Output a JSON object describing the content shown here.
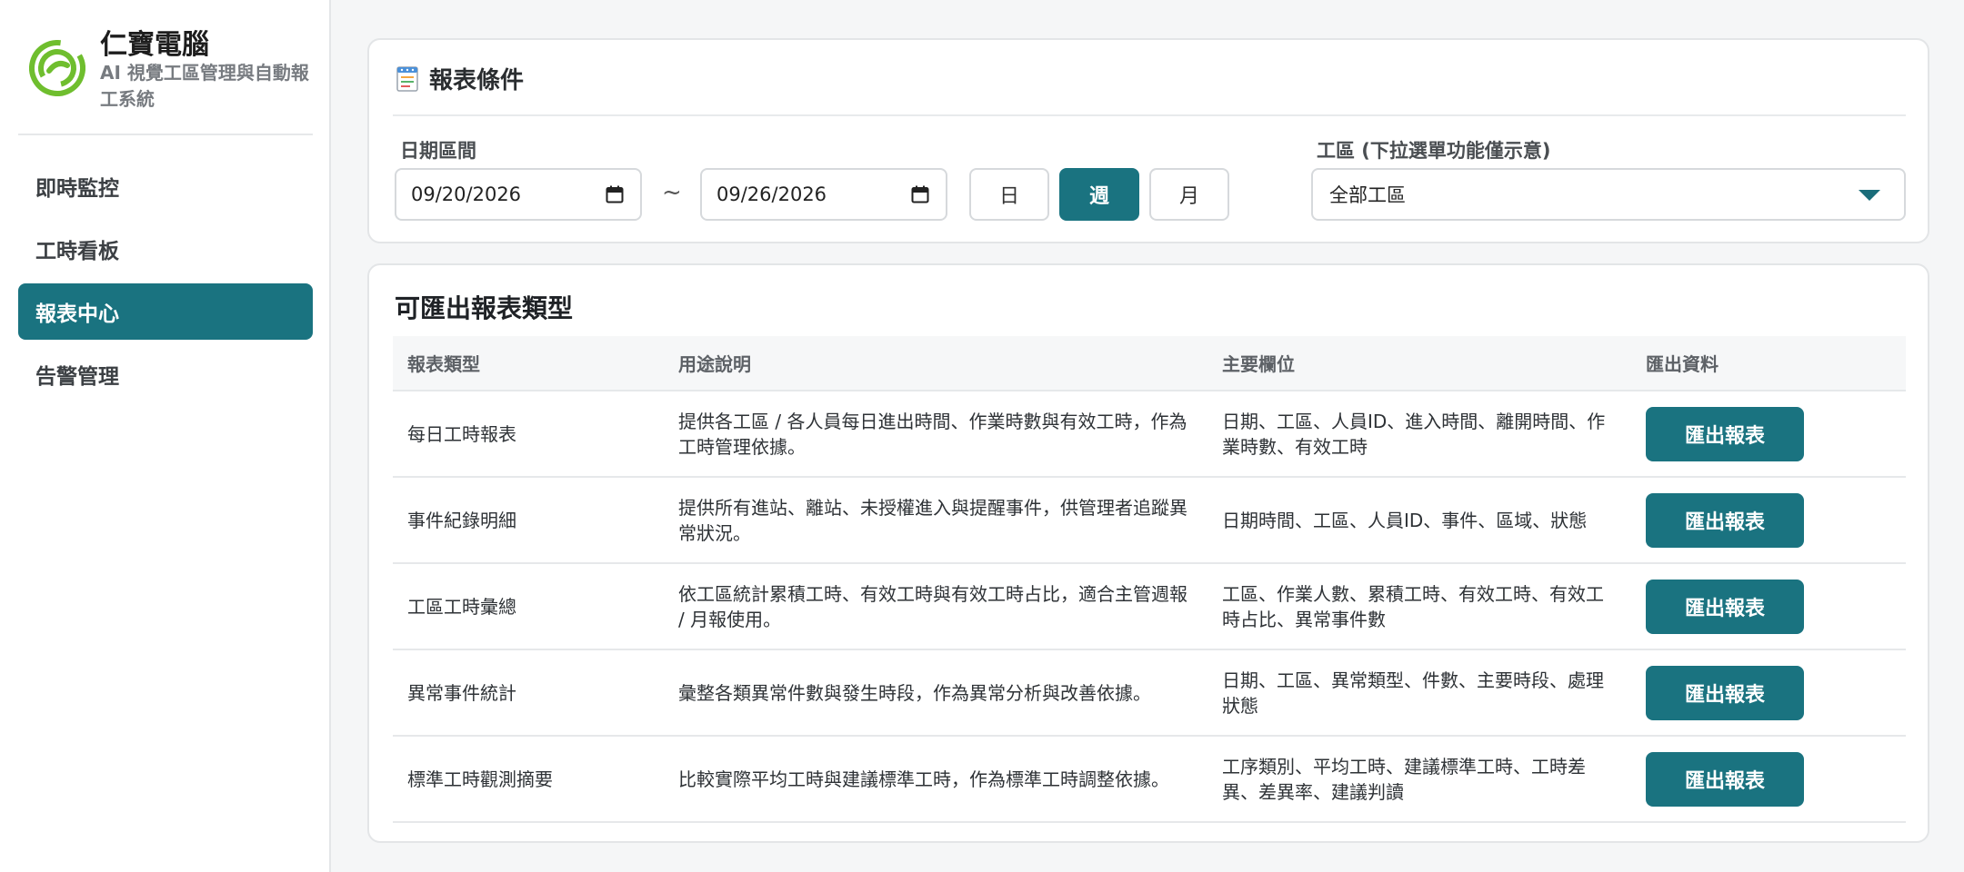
{
  "brand": {
    "name": "仁寶電腦",
    "subtitle": "AI 視覺工區管理與自動報工系統",
    "logo_color": "#6fbe2e"
  },
  "nav": {
    "items": [
      {
        "label": "即時監控",
        "active": false
      },
      {
        "label": "工時看板",
        "active": false
      },
      {
        "label": "報表中心",
        "active": true
      },
      {
        "label": "告警管理",
        "active": false
      }
    ]
  },
  "criteria": {
    "title": "報表條件",
    "date_label": "日期區間",
    "start_date": "09/20/2026",
    "separator": "~",
    "end_date": "09/26/2026",
    "period_buttons": [
      {
        "label": "日",
        "active": false
      },
      {
        "label": "週",
        "active": true
      },
      {
        "label": "月",
        "active": false
      }
    ],
    "zone_label": "工區 (下拉選單功能僅示意)",
    "zone_value": "全部工區"
  },
  "report_types": {
    "title": "可匯出報表類型",
    "headers": [
      "報表類型",
      "用途說明",
      "主要欄位",
      "匯出資料"
    ],
    "rows": [
      {
        "type": "每日工時報表",
        "description": "提供各工區 / 各人員每日進出時間、作業時數與有效工時，作為工時管理依據。",
        "fields": "日期、工區、人員ID、進入時間、離開時間、作業時數、有效工時",
        "button": "匯出報表"
      },
      {
        "type": "事件紀錄明細",
        "description": "提供所有進站、離站、未授權進入與提醒事件，供管理者追蹤異常狀況。",
        "fields": "日期時間、工區、人員ID、事件、區域、狀態",
        "button": "匯出報表"
      },
      {
        "type": "工區工時彙總",
        "description": "依工區統計累積工時、有效工時與有效工時占比，適合主管週報 / 月報使用。",
        "fields": "工區、作業人數、累積工時、有效工時、有效工時占比、異常事件數",
        "button": "匯出報表"
      },
      {
        "type": "異常事件統計",
        "description": "彙整各類異常件數與發生時段，作為異常分析與改善依據。",
        "fields": "日期、工區、異常類型、件數、主要時段、處理狀態",
        "button": "匯出報表"
      },
      {
        "type": "標準工時觀測摘要",
        "description": "比較實際平均工時與建議標準工時，作為標準工時調整依據。",
        "fields": "工序類別、平均工時、建議標準工時、工時差異、差異率、建議判讀",
        "button": "匯出報表"
      }
    ]
  },
  "colors": {
    "accent": "#1a7380",
    "background": "#f5f6f7"
  }
}
